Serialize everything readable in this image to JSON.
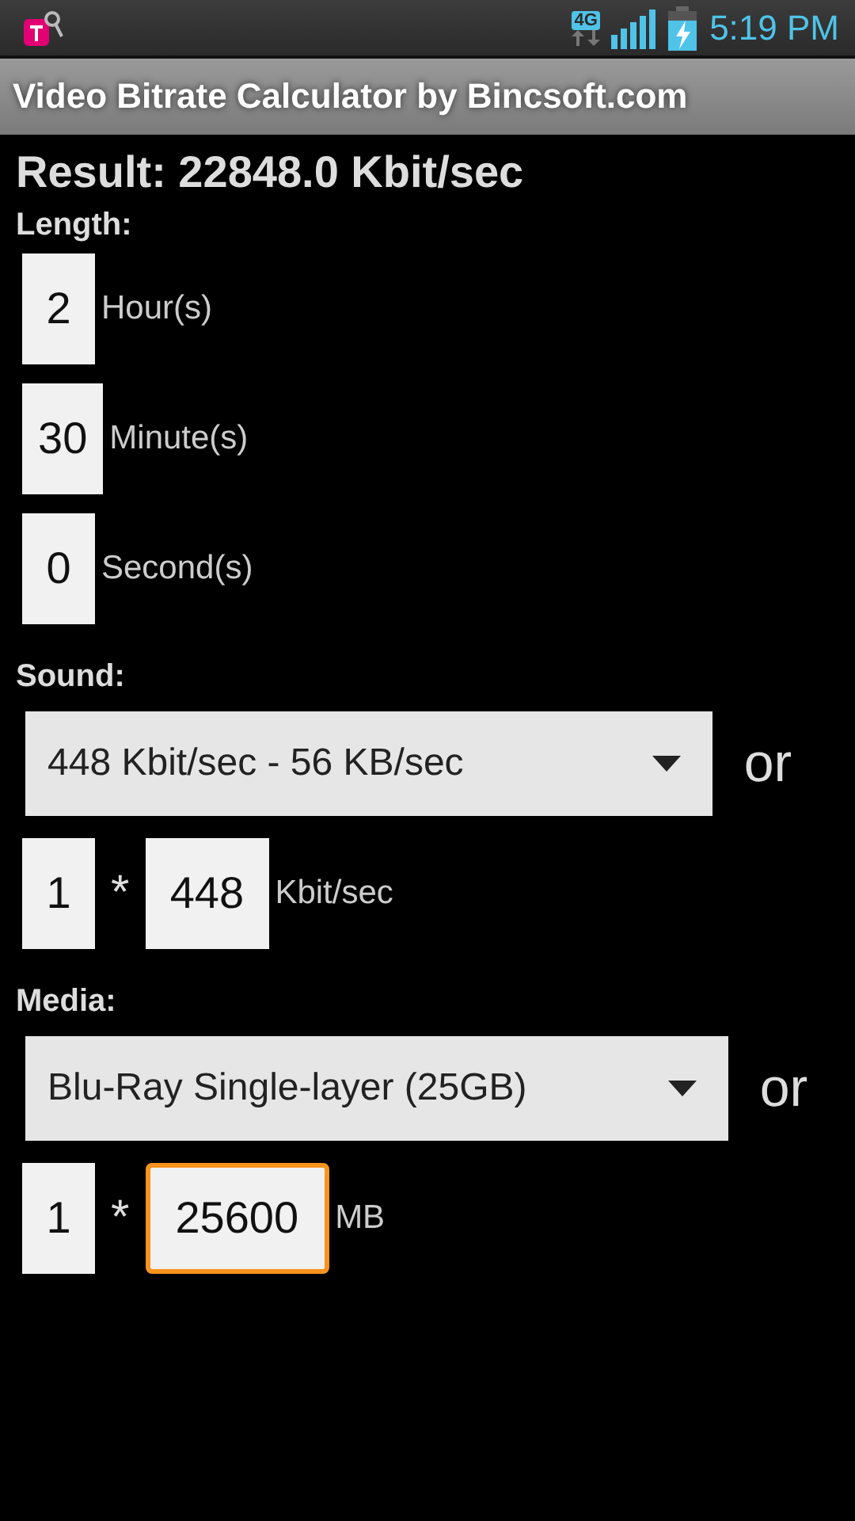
{
  "status_bar": {
    "network": "4G",
    "time": "5:19 PM"
  },
  "window": {
    "title": "Video Bitrate Calculator by Bincsoft.com"
  },
  "result": "Result: 22848.0 Kbit/sec",
  "length": {
    "label": "Length:",
    "fields": [
      {
        "value": "2",
        "unit": "Hour(s)"
      },
      {
        "value": "30",
        "unit": "Minute(s)"
      },
      {
        "value": "0",
        "unit": "Second(s)"
      }
    ]
  },
  "sections": [
    {
      "label": "Sound:",
      "dropdown": "448 Kbit/sec - 56 KB/sec",
      "or": "or",
      "count": "1",
      "operator": "*",
      "value": "448",
      "unit": "Kbit/sec",
      "focused": false
    },
    {
      "label": "Media:",
      "dropdown": "Blu-Ray Single-layer (25GB)",
      "or": "or",
      "count": "1",
      "operator": "*",
      "value": "25600",
      "unit": "MB",
      "focused": true
    }
  ]
}
